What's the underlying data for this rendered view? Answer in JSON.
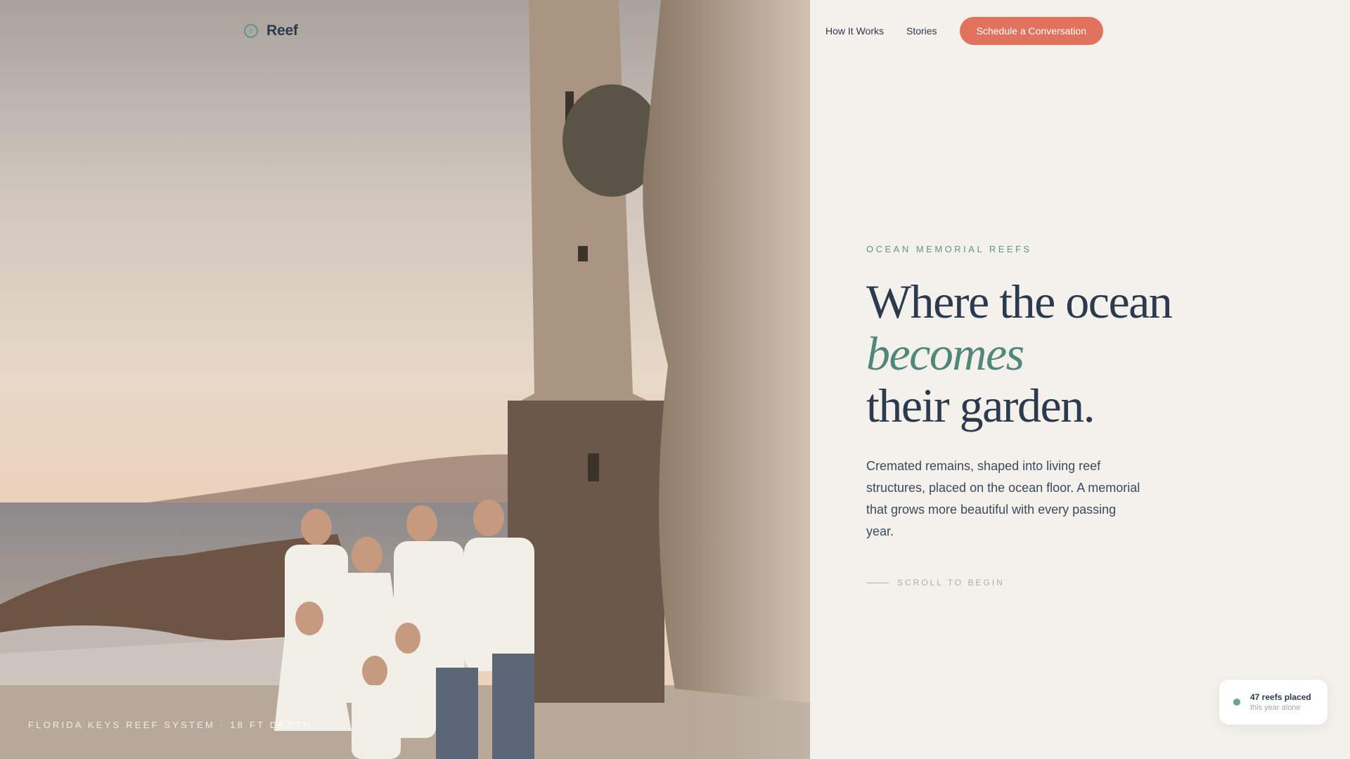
{
  "brand": {
    "name": "Reef",
    "icon": "reef-logo-icon"
  },
  "nav": {
    "links": [
      "How It Works",
      "Stories"
    ],
    "cta": "Schedule a Conversation"
  },
  "hero": {
    "eyebrow": "OCEAN MEMORIAL REEFS",
    "headline_line1": "Where the ocean",
    "headline_line2": "becomes",
    "headline_line3": "their garden.",
    "body": "Cremated remains, shaped into living reef structures, placed on the ocean floor. A memorial that grows more beautiful with every passing year.",
    "scroll_label": "SCROLL TO BEGIN"
  },
  "photo": {
    "caption": "FLORIDA KEYS REEF SYSTEM · 18 FT DEPTH",
    "alt_subject": "family-photo-at-coastal-tower"
  },
  "stat_card": {
    "value": "47 reefs placed",
    "subtitle": "this year alone"
  },
  "colors": {
    "background": "#f4f1ec",
    "accent_teal": "#4f877b",
    "cta_coral": "#e0725e",
    "ink": "#2c3a4d"
  }
}
